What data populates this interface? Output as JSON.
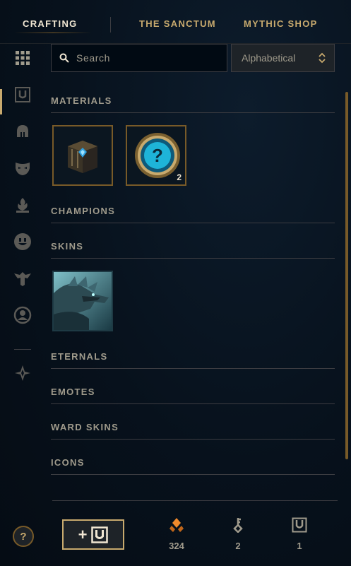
{
  "tabs": [
    {
      "label": "CRAFTING"
    },
    {
      "label": "THE SANCTUM"
    },
    {
      "label": "MYTHIC SHOP"
    }
  ],
  "search": {
    "placeholder": "Search"
  },
  "sort": {
    "selected": "Alphabetical"
  },
  "sections": {
    "materials": "MATERIALS",
    "champions": "CHAMPIONS",
    "skins": "SKINS",
    "eternals": "ETERNALS",
    "emotes": "EMOTES",
    "ward_skins": "WARD SKINS",
    "icons": "ICONS"
  },
  "materials": {
    "mystery_count": "2"
  },
  "sidebar_icons": [
    "grid-icon",
    "chest-icon",
    "helmet-icon",
    "mask-icon",
    "flame-icon",
    "emote-face-icon",
    "ward-icon",
    "profile-icon",
    "eternals-icon"
  ],
  "bottom": {
    "help": "?",
    "add_plus": "+",
    "orange_essence": "324",
    "keys": "2",
    "chests": "1"
  },
  "colors": {
    "gold": "#c8aa6e",
    "text": "#a09b8c",
    "orange": "#f08a2c",
    "background": "#07111c"
  }
}
